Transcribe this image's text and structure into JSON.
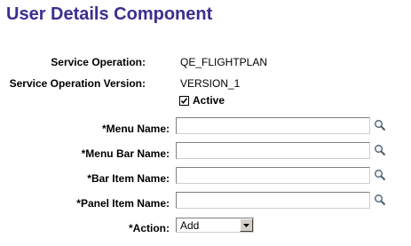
{
  "header": {
    "title": "User Details Component"
  },
  "service": {
    "operation_label": "Service Operation:",
    "operation_value": "QE_FLIGHTPLAN",
    "version_label": "Service Operation Version:",
    "version_value": "VERSION_1",
    "active_label": "Active",
    "active_checked": true
  },
  "fields": {
    "menu_name": {
      "label": "*Menu Name:",
      "value": ""
    },
    "menu_bar_name": {
      "label": "*Menu Bar Name:",
      "value": ""
    },
    "bar_item_name": {
      "label": "*Bar Item Name:",
      "value": ""
    },
    "panel_item_name": {
      "label": "*Panel Item Name:",
      "value": ""
    },
    "action": {
      "label": "*Action:",
      "selected": "Add"
    }
  },
  "icons": {
    "lookup": "magnifying-glass-icon",
    "dropdown": "triangle-down-icon",
    "check": "check-mark-icon"
  },
  "colors": {
    "title": "#3a2f8f",
    "input_border": "#7f7f7f"
  }
}
